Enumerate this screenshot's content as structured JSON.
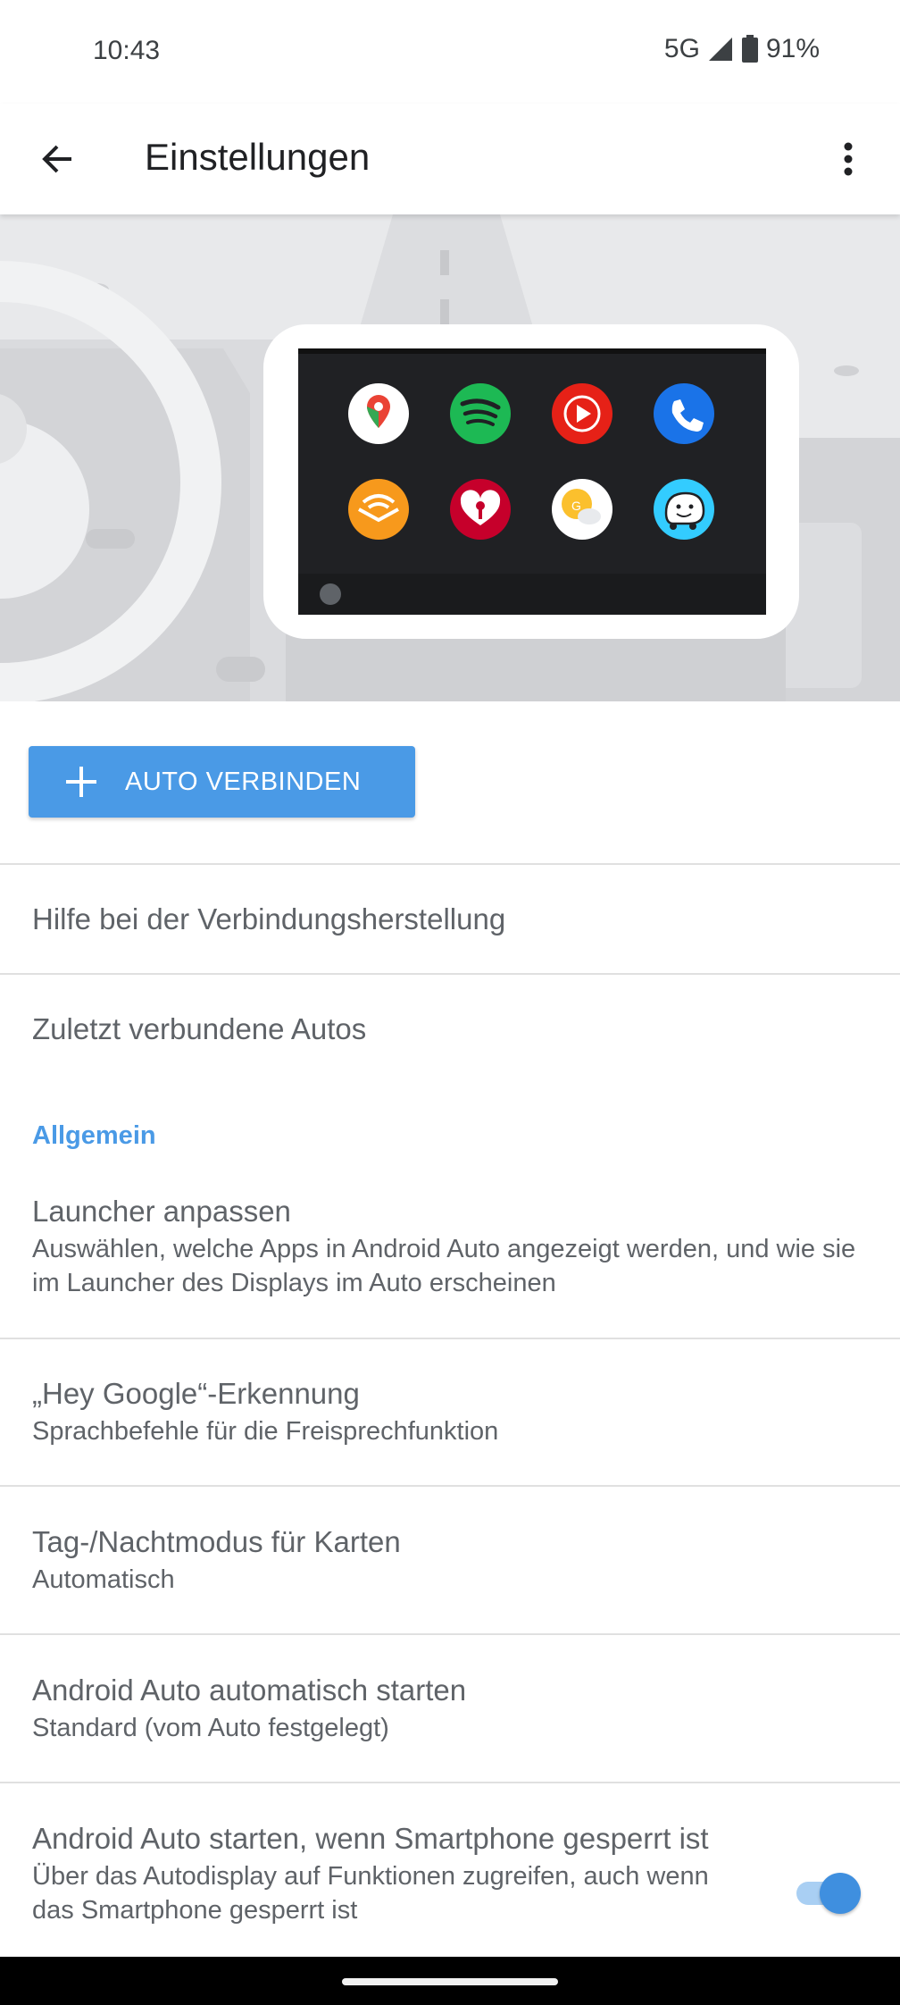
{
  "status_bar": {
    "time": "10:43",
    "network": "5G",
    "battery": "91%"
  },
  "app_bar": {
    "title": "Einstellungen",
    "back_icon": "arrow-left-icon",
    "menu_icon": "more-vert-icon"
  },
  "hero": {
    "apps": [
      {
        "name": "maps-icon",
        "bg": "#ffffff"
      },
      {
        "name": "spotify-icon",
        "bg": "#1db954"
      },
      {
        "name": "youtube-music-icon",
        "bg": "#e62117"
      },
      {
        "name": "phone-icon",
        "bg": "#1a73e8"
      },
      {
        "name": "audible-icon",
        "bg": "#f7991c"
      },
      {
        "name": "iheartradio-icon",
        "bg": "#c6002b"
      },
      {
        "name": "weather-icon",
        "bg": "#ffffff"
      },
      {
        "name": "waze-icon",
        "bg": "#33ccff"
      }
    ]
  },
  "connect_button": {
    "label": "AUTO VERBINDEN"
  },
  "links": {
    "help": "Hilfe bei der Verbindungsherstellung",
    "recent_cars": "Zuletzt verbundene Autos"
  },
  "general": {
    "header": "Allgemein",
    "items": [
      {
        "title": "Launcher anpassen",
        "subtitle": "Auswählen, welche Apps in Android Auto angezeigt werden, und wie sie im Launcher des Displays im Auto erscheinen"
      },
      {
        "title": "„Hey Google“-Erkennung",
        "subtitle": "Sprachbefehle für die Freisprechfunktion"
      },
      {
        "title": "Tag-/Nachtmodus für Karten",
        "subtitle": "Automatisch"
      },
      {
        "title": "Android Auto automatisch starten",
        "subtitle": "Standard (vom Auto festgelegt)"
      },
      {
        "title": "Android Auto starten, wenn Smartphone gesperrt ist",
        "subtitle": "Über das Autodisplay auf Funktionen zugreifen, auch wenn das Smartphone gesperrt ist",
        "toggle_on": true
      }
    ]
  },
  "colors": {
    "accent": "#4a9ae6"
  }
}
